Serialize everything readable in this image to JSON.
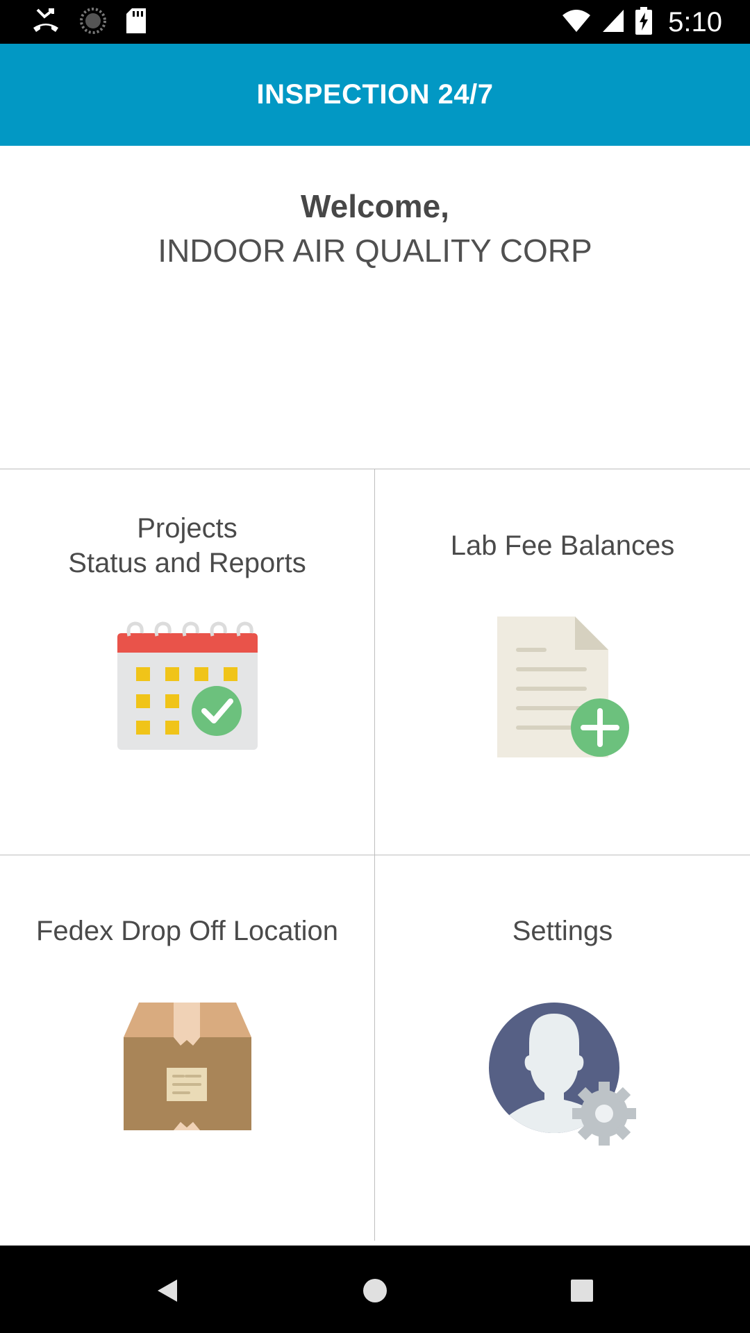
{
  "status_bar": {
    "time": "5:10",
    "icons": [
      "missed-call-icon",
      "loading-icon",
      "sd-card-icon",
      "wifi-icon",
      "cell-signal-icon",
      "battery-charging-icon"
    ]
  },
  "app_bar": {
    "title": "INSPECTION 24/7",
    "color": "#0298c4"
  },
  "welcome": {
    "greeting": "Welcome,",
    "company": "INDOOR AIR QUALITY CORP"
  },
  "menu": {
    "projects": {
      "line1": "Projects",
      "line2": "Status and Reports",
      "icon": "calendar-check-icon"
    },
    "lab_fees": {
      "label": "Lab Fee Balances",
      "icon": "document-add-icon"
    },
    "fedex": {
      "label": "Fedex Drop Off Location",
      "icon": "package-box-icon"
    },
    "settings": {
      "label": "Settings",
      "icon": "user-settings-icon"
    }
  },
  "nav_bar": {
    "buttons": [
      "back-icon",
      "home-icon",
      "recents-icon"
    ]
  }
}
